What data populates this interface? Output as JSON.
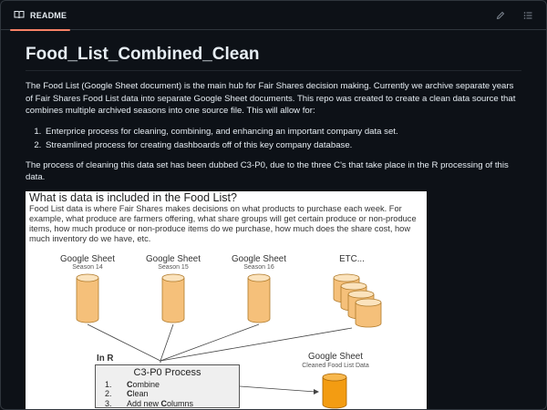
{
  "tab": {
    "label": "README",
    "icon": "book-icon"
  },
  "actions": [
    {
      "name": "edit-button",
      "icon": "pencil-icon"
    },
    {
      "name": "outline-button",
      "icon": "list-icon"
    }
  ],
  "readme": {
    "title": "Food_List_Combined_Clean",
    "intro": "The Food List (Google Sheet document) is the main hub for Fair Shares decision making. Currently we archive separate years of Fair Shares Food List data into separate Google Sheet documents. This repo was created to create a clean data source that combines multiple archived seasons into one source file. This will allow for:",
    "list": [
      "Enterprice process for cleaning, combining, and enhancing an important company data set.",
      "Streamlined process for creating dashboards off of this key company database."
    ],
    "process_text": "The process of cleaning this data set has been dubbed C3-P0, due to the three C's that take place in the R processing of this data."
  },
  "diagram": {
    "title": "What is data is included in the Food List?",
    "intro": "Food List data is where Fair Shares makes decisions on what products to purchase each week. For example, what produce are farmers offering, what share groups will get certain produce or non-produce items, how much produce or non-produce items do we purchase, how much does the share cost, how much inventory do we have, etc.",
    "sources": [
      {
        "label": "Google Sheet",
        "sub": "Season 14"
      },
      {
        "label": "Google Sheet",
        "sub": "Season 15"
      },
      {
        "label": "Google Sheet",
        "sub": "Season 16"
      },
      {
        "label": "ETC...",
        "sub": ""
      }
    ],
    "in_r": "In R",
    "process": {
      "title": "C3-P0 Process",
      "steps": [
        {
          "n": "1.",
          "bold": "C",
          "rest": "ombine"
        },
        {
          "n": "2.",
          "bold": "C",
          "rest": "lean"
        },
        {
          "n": "3.",
          "bold": "",
          "rest": "Add new ",
          "bold2": "C",
          "rest2": "olumns"
        }
      ]
    },
    "output": {
      "label": "Google Sheet",
      "sub": "Cleaned Food List Data"
    },
    "colors": {
      "cylinder": "#f5c07a",
      "cylinder_top": "#fbe3bd",
      "output": "#f39c12",
      "stroke": "#444444"
    }
  }
}
